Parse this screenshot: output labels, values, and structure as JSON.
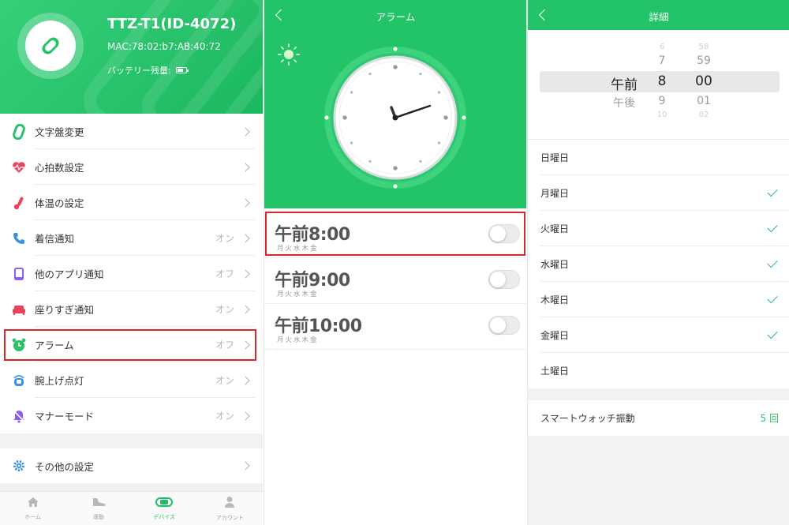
{
  "device_panel": {
    "device_name": "TTZ-T1(ID-4072)",
    "mac": "MAC:78:02:b7:AB:40:72",
    "battery_label": "バッテリー残量:",
    "menu": [
      {
        "label": "文字盤変更",
        "value": "",
        "icon": "watch-face-icon",
        "color": "#2fbf6b"
      },
      {
        "label": "心拍数設定",
        "value": "",
        "icon": "heart-rate-icon",
        "color": "#e9445a"
      },
      {
        "label": "体温の設定",
        "value": "",
        "icon": "thermometer-icon",
        "color": "#e9445a"
      },
      {
        "label": "着信通知",
        "value": "オン",
        "icon": "phone-icon",
        "color": "#3b8fe4"
      },
      {
        "label": "他のアプリ通知",
        "value": "オフ",
        "icon": "app-notification-icon",
        "color": "#8b5cf6"
      },
      {
        "label": "座りすぎ通知",
        "value": "オン",
        "icon": "sofa-icon",
        "color": "#e9445a"
      },
      {
        "label": "アラーム",
        "value": "オフ",
        "icon": "alarm-clock-icon",
        "color": "#2fbf6b"
      },
      {
        "label": "腕上げ点灯",
        "value": "オン",
        "icon": "raise-wrist-icon",
        "color": "#3b8fe4"
      },
      {
        "label": "マナーモード",
        "value": "オン",
        "icon": "silent-bell-icon",
        "color": "#8b5cf6"
      }
    ],
    "other_settings": {
      "label": "その他の設定",
      "icon": "gear-icon",
      "color": "#3b8fe4"
    },
    "tabs": [
      {
        "label": "ホーム",
        "icon": "home-icon",
        "active": false
      },
      {
        "label": "運動",
        "icon": "shoe-icon",
        "active": false
      },
      {
        "label": "デバイス",
        "icon": "band-icon",
        "active": true
      },
      {
        "label": "アカウント",
        "icon": "person-icon",
        "active": false
      }
    ]
  },
  "alarm_panel": {
    "title": "アラーム",
    "alarms": [
      {
        "time": "午前8:00",
        "days": "月火水木金",
        "enabled": false
      },
      {
        "time": "午前9:00",
        "days": "月火水木金",
        "enabled": false
      },
      {
        "time": "午前10:00",
        "days": "月火水木金",
        "enabled": false
      }
    ]
  },
  "detail_panel": {
    "title": "詳細",
    "picker": {
      "ampm": {
        "above": "",
        "selected": "午前",
        "below": "午後"
      },
      "hour": {
        "faint_above": "6",
        "above": "7",
        "selected": "8",
        "below": "9",
        "faint_below": "10"
      },
      "minute": {
        "faint_above": "58",
        "above": "59",
        "selected": "00",
        "below": "01",
        "faint_below": "02"
      }
    },
    "days": [
      {
        "label": "日曜日",
        "checked": false
      },
      {
        "label": "月曜日",
        "checked": true
      },
      {
        "label": "火曜日",
        "checked": true
      },
      {
        "label": "水曜日",
        "checked": true
      },
      {
        "label": "木曜日",
        "checked": true
      },
      {
        "label": "金曜日",
        "checked": true
      },
      {
        "label": "土曜日",
        "checked": false
      }
    ],
    "vibration": {
      "label": "スマートウォッチ振動",
      "value": "5 回"
    }
  },
  "colors": {
    "accent": "#22c467",
    "highlight": "#d9262c",
    "check": "#2fbf6b"
  }
}
